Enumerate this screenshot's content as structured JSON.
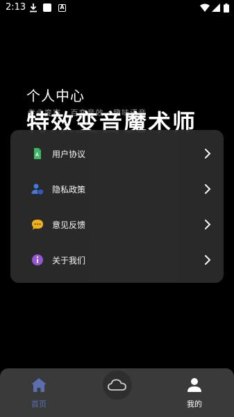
{
  "status_bar": {
    "time": "2:13"
  },
  "header": {
    "title": "个人中心",
    "app_name": "特效变音魔术师",
    "app_name_subtext": "专业变声 · 百变音效 · 趣味语音"
  },
  "menu": {
    "items": [
      {
        "label": "用户协议",
        "icon": "document-icon"
      },
      {
        "label": "隐私政策",
        "icon": "user-shield-icon"
      },
      {
        "label": "意见反馈",
        "icon": "chat-bubble-icon"
      },
      {
        "label": "关于我们",
        "icon": "info-icon"
      }
    ]
  },
  "bottom_nav": {
    "home_label": "首页",
    "center_icon": "cloud-icon",
    "mine_label": "我的",
    "active_color": "#5b6fb0"
  }
}
